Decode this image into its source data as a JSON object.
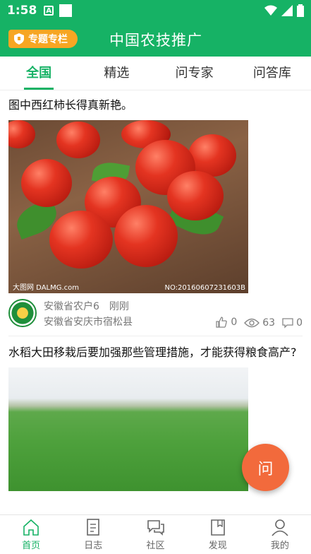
{
  "status_bar": {
    "time": "1:58",
    "icon_a": "A"
  },
  "app_bar": {
    "special_label": "专题专栏",
    "title": "中国农技推广"
  },
  "tabs": [
    {
      "label": "全国",
      "active": true
    },
    {
      "label": "精选",
      "active": false
    },
    {
      "label": "问专家",
      "active": false
    },
    {
      "label": "问答库",
      "active": false
    }
  ],
  "posts": [
    {
      "title": "图中西红柿长得真新艳。",
      "image_watermark_left": "大图网 DALMG.com",
      "image_watermark_right": "NO:20160607231603B",
      "author": "安徽省农户6",
      "time": "刚刚",
      "location": "安徽省安庆市宿松县",
      "likes": "0",
      "views": "63",
      "comments": "0"
    },
    {
      "title": "水稻大田移栽后要加强那些管理措施，才能获得粮食高产?"
    }
  ],
  "fab": {
    "label": "问"
  },
  "bottom_nav": [
    {
      "label": "首页",
      "icon": "home-icon",
      "active": true
    },
    {
      "label": "日志",
      "icon": "log-icon",
      "active": false
    },
    {
      "label": "社区",
      "icon": "community-icon",
      "active": false
    },
    {
      "label": "发现",
      "icon": "discover-icon",
      "active": false
    },
    {
      "label": "我的",
      "icon": "profile-icon",
      "active": false
    }
  ],
  "colors": {
    "primary": "#16b265",
    "accent": "#f7a623",
    "fab": "#f26a3c"
  }
}
